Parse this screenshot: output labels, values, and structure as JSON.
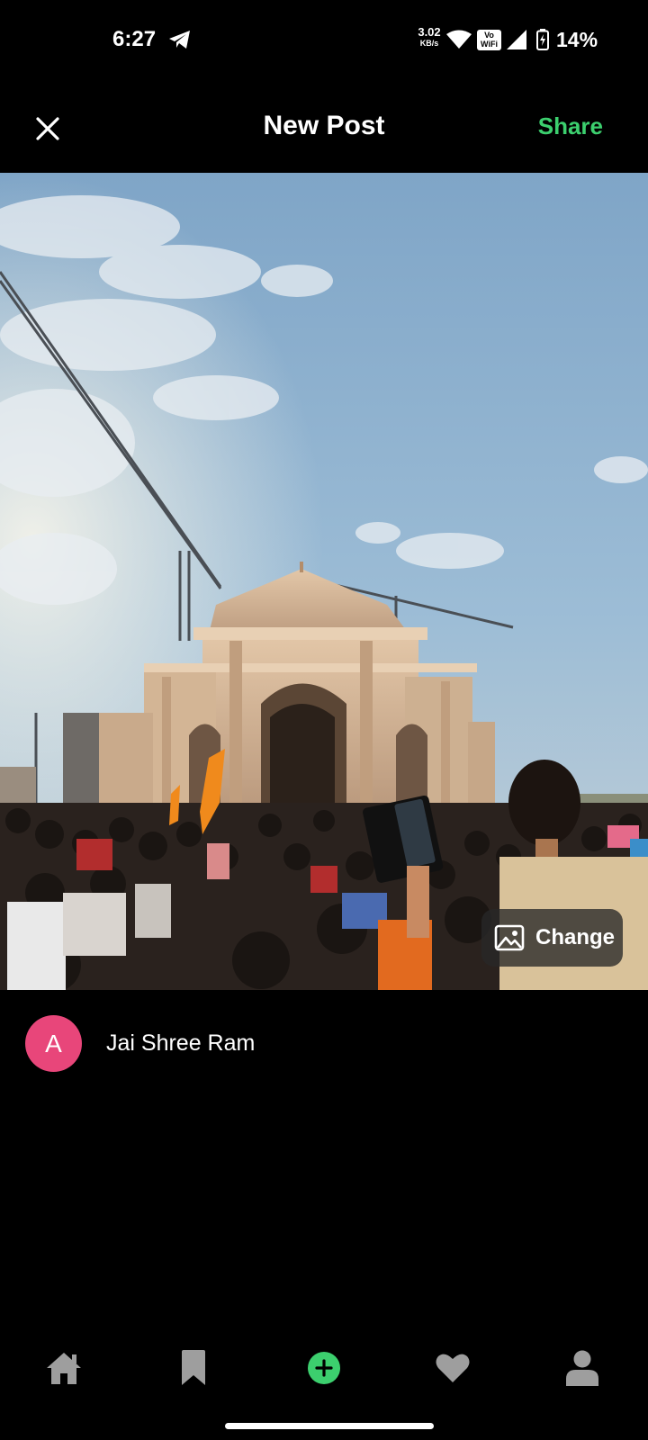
{
  "status_bar": {
    "time": "6:27",
    "net_speed_value": "3.02",
    "net_speed_unit": "KB/s",
    "vowifi_line1": "Vo",
    "vowifi_line2": "WiFi",
    "battery_percent": "14%"
  },
  "header": {
    "title": "New Post",
    "share_label": "Share"
  },
  "photo": {
    "change_label": "Change"
  },
  "post": {
    "avatar_letter": "A",
    "caption": "Jai Shree Ram"
  },
  "icons": {
    "close": "close-icon",
    "change": "image-icon",
    "nav": [
      "home-icon",
      "bookmark-icon",
      "add-circle-icon",
      "heart-icon",
      "profile-icon"
    ]
  },
  "colors": {
    "accent": "#3ccf6e",
    "avatar_bg": "#e8467a",
    "background": "#000000",
    "nav_icon": "#9e9e9e"
  }
}
